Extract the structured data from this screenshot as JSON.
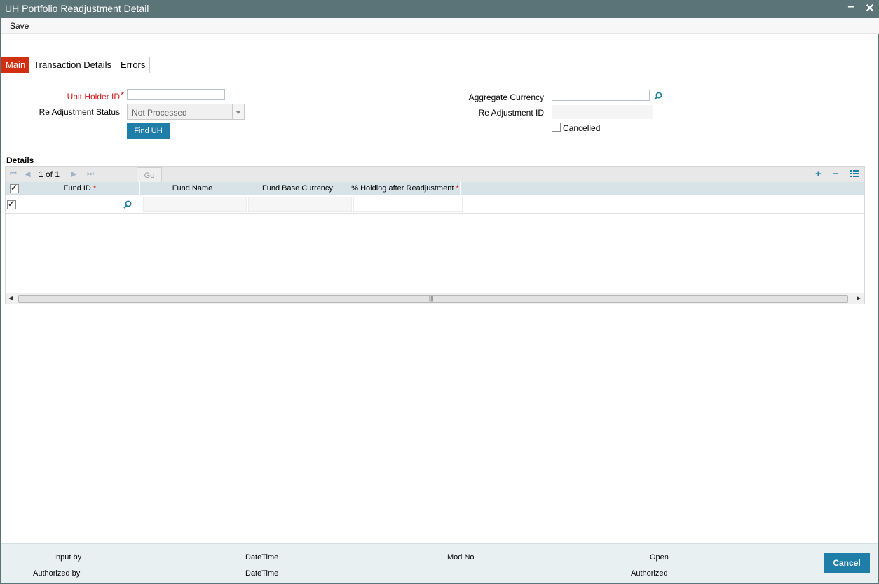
{
  "window": {
    "title": "UH Portfolio Readjustment Detail",
    "minimize_label": "−",
    "close_label": "✕"
  },
  "menu": {
    "save_label": "Save"
  },
  "tabs": [
    {
      "label": "Main"
    },
    {
      "label": "Transaction Details"
    },
    {
      "label": "Errors"
    }
  ],
  "form": {
    "unit_holder_id_label": "Unit Holder ID",
    "unit_holder_id_value": "",
    "required_mark": "*",
    "readjustment_status_label": "Re Adjustment Status",
    "readjustment_status_value": "Not Processed",
    "find_uh_label": "Find UH",
    "aggregate_currency_label": "Aggregate Currency",
    "aggregate_currency_value": "",
    "readjustment_id_label": "Re Adjustment ID",
    "readjustment_id_value": "",
    "cancelled_label": "Cancelled",
    "cancelled_checked": false
  },
  "details": {
    "title": "Details",
    "page_info": "1 of 1",
    "go_label": "Go",
    "columns": [
      {
        "label": "Fund ID",
        "required": true
      },
      {
        "label": "Fund Name",
        "required": false
      },
      {
        "label": "Fund Base Currency",
        "required": false
      },
      {
        "label": "% Holding after Readjustment",
        "required": true
      }
    ],
    "rows": [
      {
        "checked": true,
        "fund_id": "",
        "fund_name": "",
        "fund_base_currency": "",
        "holding_pct": ""
      }
    ],
    "header_checked": true
  },
  "footer": {
    "input_by": "Input by",
    "datetime1": "DateTime",
    "mod_no": "Mod No",
    "open": "Open",
    "authorized_by": "Authorized by",
    "datetime2": "DateTime",
    "authorized": "Authorized",
    "cancel_label": "Cancel"
  },
  "colors": {
    "titlebar": "#5b7478",
    "active_tab": "#d12f12",
    "accent": "#1f7ea8",
    "required": "#d11a1a"
  }
}
